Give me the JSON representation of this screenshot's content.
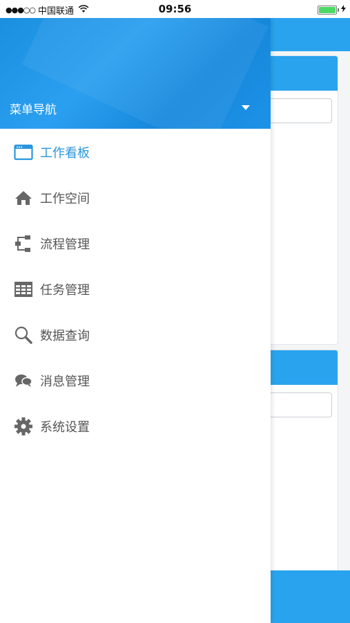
{
  "status_bar": {
    "signal": "●●●○○",
    "carrier": "中国联通",
    "time": "09:56"
  },
  "drawer": {
    "title": "菜单导航",
    "items": [
      {
        "label": "工作看板",
        "icon": "dashboard-icon",
        "active": true
      },
      {
        "label": "工作空间",
        "icon": "home-icon",
        "active": false
      },
      {
        "label": "流程管理",
        "icon": "flow-icon",
        "active": false
      },
      {
        "label": "任务管理",
        "icon": "table-icon",
        "active": false
      },
      {
        "label": "数据查询",
        "icon": "search-icon",
        "active": false
      },
      {
        "label": "消息管理",
        "icon": "chat-icon",
        "active": false
      },
      {
        "label": "系统设置",
        "icon": "gear-icon",
        "active": false
      }
    ]
  },
  "colors": {
    "accent": "#2a96dc",
    "header_blue": "#1a8fe0",
    "menu_text": "#555555",
    "icon_gray": "#666666"
  }
}
